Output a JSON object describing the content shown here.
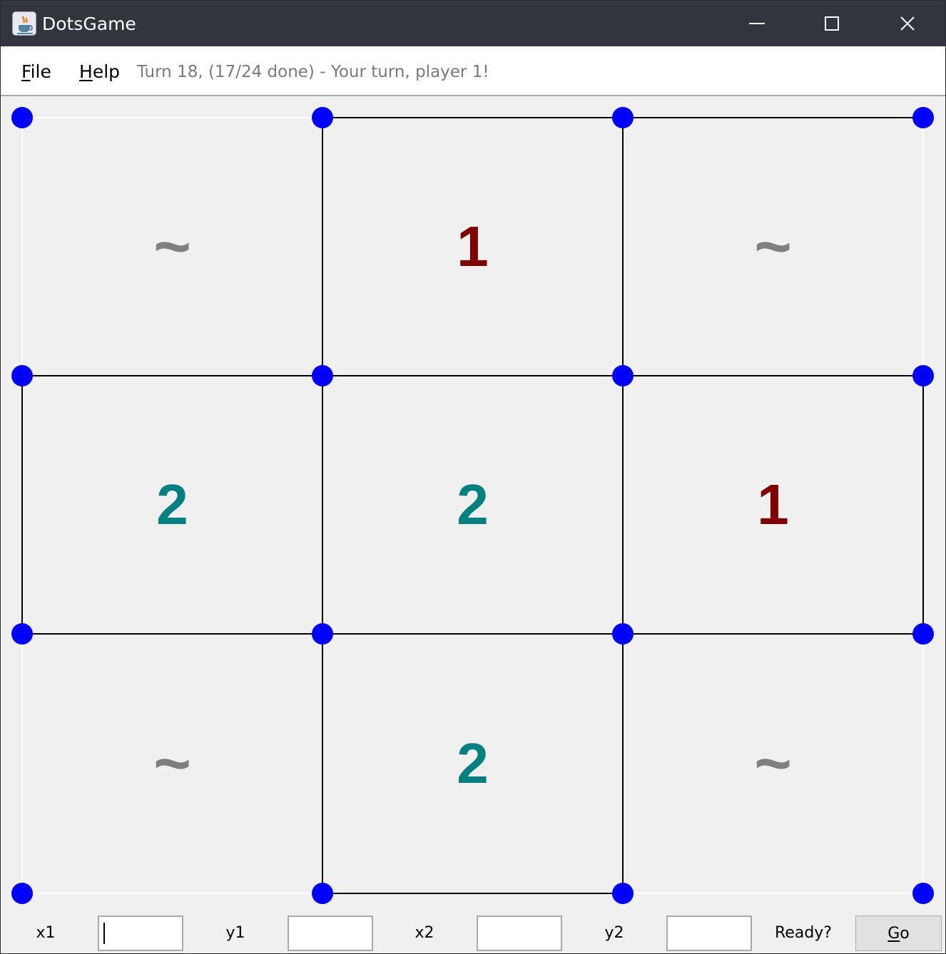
{
  "window": {
    "title": "DotsGame",
    "icon": "java-coffee-cup-icon",
    "controls": [
      "minimize-icon",
      "maximize-icon",
      "close-icon"
    ]
  },
  "menu": {
    "file": {
      "mnemonic": "F",
      "rest": "ile"
    },
    "help": {
      "mnemonic": "H",
      "rest": "elp"
    }
  },
  "status": "Turn 18, (17/24 done) - Your turn, player 1!",
  "board": {
    "dots_per_side": 4,
    "dot_color": "#0000ff",
    "drawn_line_color": "#000000",
    "undrawn_line_color": "#ffffff",
    "horizontal_lines": [
      [
        false,
        true,
        true
      ],
      [
        true,
        true,
        true
      ],
      [
        true,
        true,
        true
      ],
      [
        false,
        true,
        false
      ]
    ],
    "vertical_lines": [
      [
        false,
        true,
        true,
        false
      ],
      [
        true,
        true,
        true,
        true
      ],
      [
        false,
        true,
        true,
        false
      ]
    ],
    "boxes": [
      [
        {
          "owner": "~",
          "color": "#7f7f7f"
        },
        {
          "owner": "1",
          "color": "#800000"
        },
        {
          "owner": "~",
          "color": "#7f7f7f"
        }
      ],
      [
        {
          "owner": "2",
          "color": "#008080"
        },
        {
          "owner": "2",
          "color": "#008080"
        },
        {
          "owner": "1",
          "color": "#800000"
        }
      ],
      [
        {
          "owner": "~",
          "color": "#7f7f7f"
        },
        {
          "owner": "2",
          "color": "#008080"
        },
        {
          "owner": "~",
          "color": "#7f7f7f"
        }
      ]
    ]
  },
  "controls": {
    "x1_label": "x1",
    "y1_label": "y1",
    "x2_label": "x2",
    "y2_label": "y2",
    "x1_value": "",
    "y1_value": "",
    "x2_value": "",
    "y2_value": "",
    "ready_label": "Ready?",
    "go": {
      "mnemonic": "G",
      "rest": "o"
    }
  }
}
